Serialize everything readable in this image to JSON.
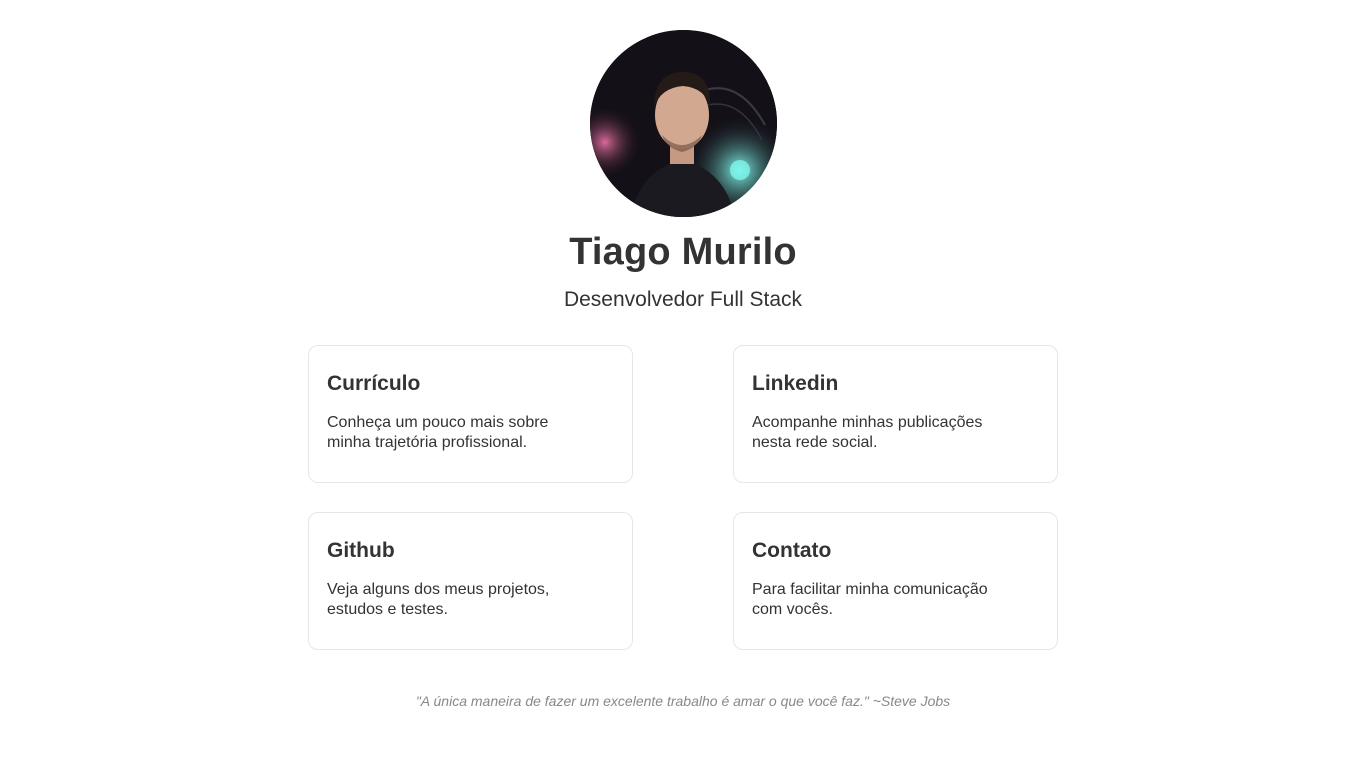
{
  "profile": {
    "photo": "profile-photo",
    "name": "Tiago Murilo",
    "role": "Desenvolvedor Full Stack"
  },
  "cards": [
    {
      "title": "Currículo",
      "description": "Conheça um pouco mais sobre minha trajetória profissional."
    },
    {
      "title": "Linkedin",
      "description": "Acompanhe minhas publicações nesta rede social."
    },
    {
      "title": "Github",
      "description": "Veja alguns dos meus projetos, estudos e testes."
    },
    {
      "title": "Contato",
      "description": "Para facilitar minha comunicação com vocês."
    }
  ],
  "footer": {
    "quote": "\"A única maneira de fazer um excelente trabalho é amar o que você faz.\" ~Steve Jobs"
  },
  "colors": {
    "text": "#333333",
    "card_border": "#e6e6e6",
    "quote": "#888888",
    "background": "#ffffff"
  }
}
